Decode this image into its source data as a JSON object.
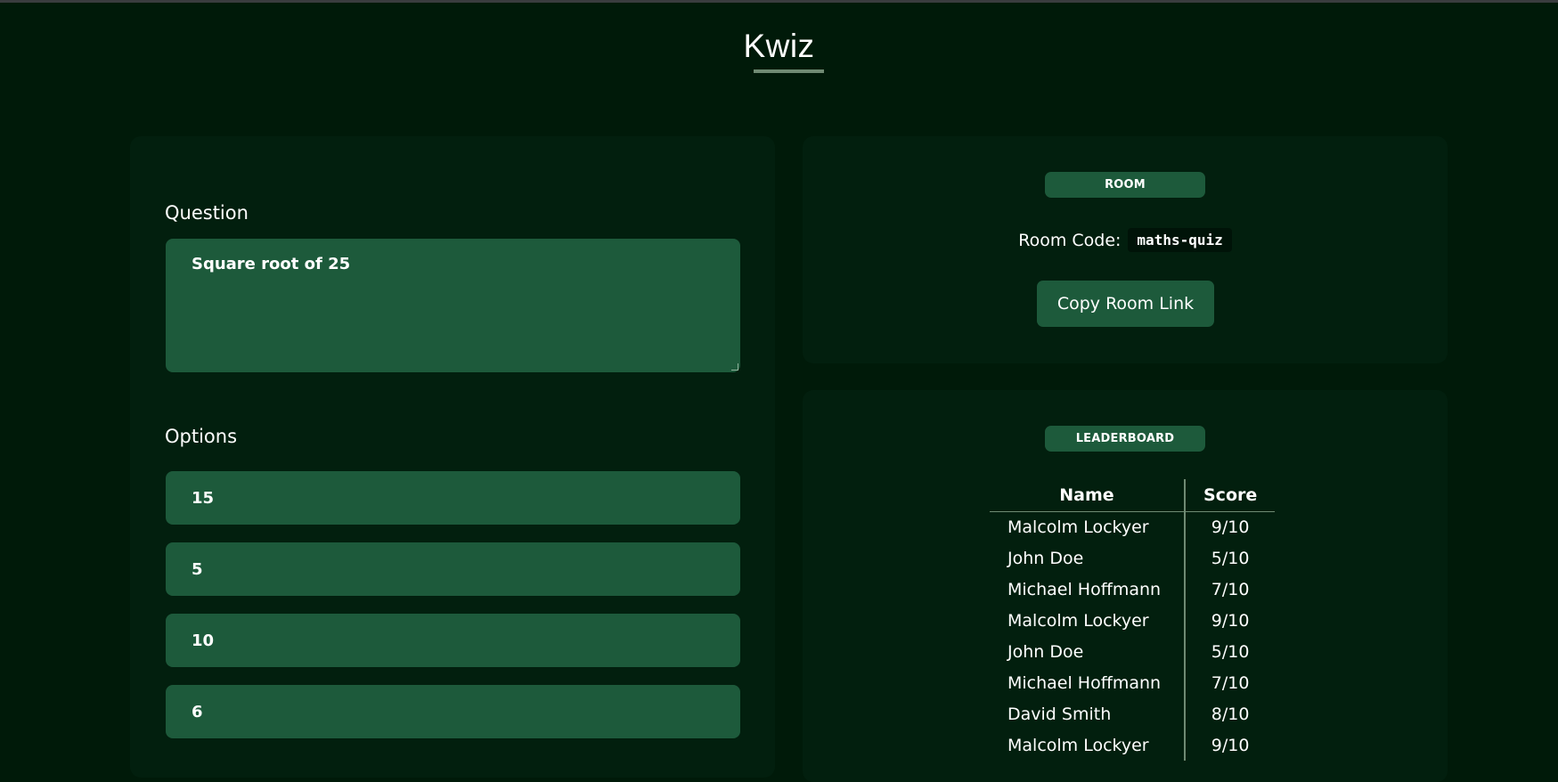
{
  "app": {
    "title": "Kwiz"
  },
  "question_form": {
    "question_label": "Question",
    "question_value": "Square root of 25",
    "options_label": "Options",
    "options": [
      "15",
      "5",
      "10",
      "6"
    ]
  },
  "room": {
    "badge": "ROOM",
    "code_label": "Room Code:",
    "code": "maths-quiz",
    "copy_button": "Copy Room Link"
  },
  "leaderboard": {
    "badge": "LEADERBOARD",
    "columns": [
      "Name",
      "Score"
    ],
    "rows": [
      {
        "name": "Malcolm Lockyer",
        "score": "9/10"
      },
      {
        "name": "John Doe",
        "score": "5/10"
      },
      {
        "name": "Michael Hoffmann",
        "score": "7/10"
      },
      {
        "name": "Malcolm Lockyer",
        "score": "9/10"
      },
      {
        "name": "John Doe",
        "score": "5/10"
      },
      {
        "name": "Michael Hoffmann",
        "score": "7/10"
      },
      {
        "name": "David Smith",
        "score": "8/10"
      },
      {
        "name": "Malcolm Lockyer",
        "score": "9/10"
      }
    ]
  },
  "colors": {
    "background": "#001a09",
    "card": "#021f0e",
    "accent": "#1d5a3b",
    "divider": "#6f8a73"
  }
}
